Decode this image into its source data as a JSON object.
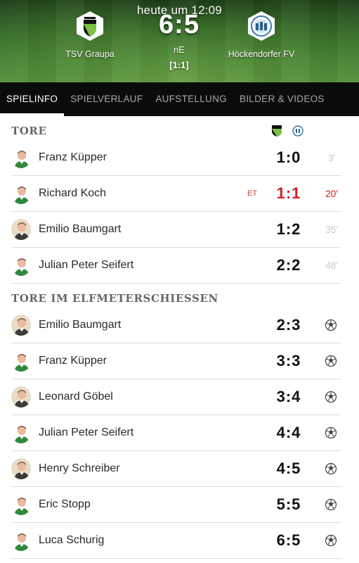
{
  "status_time": "heute um 12:09",
  "match": {
    "home_team": "TSV Graupa",
    "away_team": "Höckendorfer FV",
    "score": "6:5",
    "result_type": "nE",
    "halftime_score": "[1:1]"
  },
  "tabs": [
    {
      "label": "SPIELINFO",
      "active": true
    },
    {
      "label": "SPIELVERLAUF",
      "active": false
    },
    {
      "label": "AUFSTELLUNG",
      "active": false
    },
    {
      "label": "BILDER & VIDEOS",
      "active": false
    }
  ],
  "goals_section": {
    "title": "TORE",
    "goals": [
      {
        "player": "Franz Küpper",
        "score": "1:0",
        "minute": "3'",
        "team": "home",
        "marker": "",
        "highlight": false
      },
      {
        "player": "Richard Koch",
        "score": "1:1",
        "minute": "20'",
        "team": "home",
        "marker": "ET",
        "highlight": true
      },
      {
        "player": "Emilio Baumgart",
        "score": "1:2",
        "minute": "35'",
        "team": "away",
        "marker": "",
        "highlight": false
      },
      {
        "player": "Julian Peter Seifert",
        "score": "2:2",
        "minute": "48'",
        "team": "home",
        "marker": "",
        "highlight": false
      }
    ]
  },
  "penalties_section": {
    "title": "TORE IM ELFMETERSCHIESSEN",
    "goals": [
      {
        "player": "Emilio Baumgart",
        "score": "2:3",
        "team": "away"
      },
      {
        "player": "Franz Küpper",
        "score": "3:3",
        "team": "home"
      },
      {
        "player": "Leonard Göbel",
        "score": "3:4",
        "team": "away"
      },
      {
        "player": "Julian Peter Seifert",
        "score": "4:4",
        "team": "home"
      },
      {
        "player": "Henry Schreiber",
        "score": "4:5",
        "team": "away"
      },
      {
        "player": "Eric Stopp",
        "score": "5:5",
        "team": "home"
      },
      {
        "player": "Luca Schurig",
        "score": "6:5",
        "team": "home"
      }
    ]
  },
  "icons": {
    "home_crest": "tsv-graupa-crest-icon",
    "away_crest": "hoeckendorfer-fv-crest-icon",
    "penalty": "penalty-ball-icon",
    "avatar": "player-avatar-icon"
  },
  "colors": {
    "accent_red": "#d11f1f",
    "tab_bar": "#0b0b0b",
    "home_green": "#2f8a3c",
    "away_blue": "#3a78a8"
  }
}
